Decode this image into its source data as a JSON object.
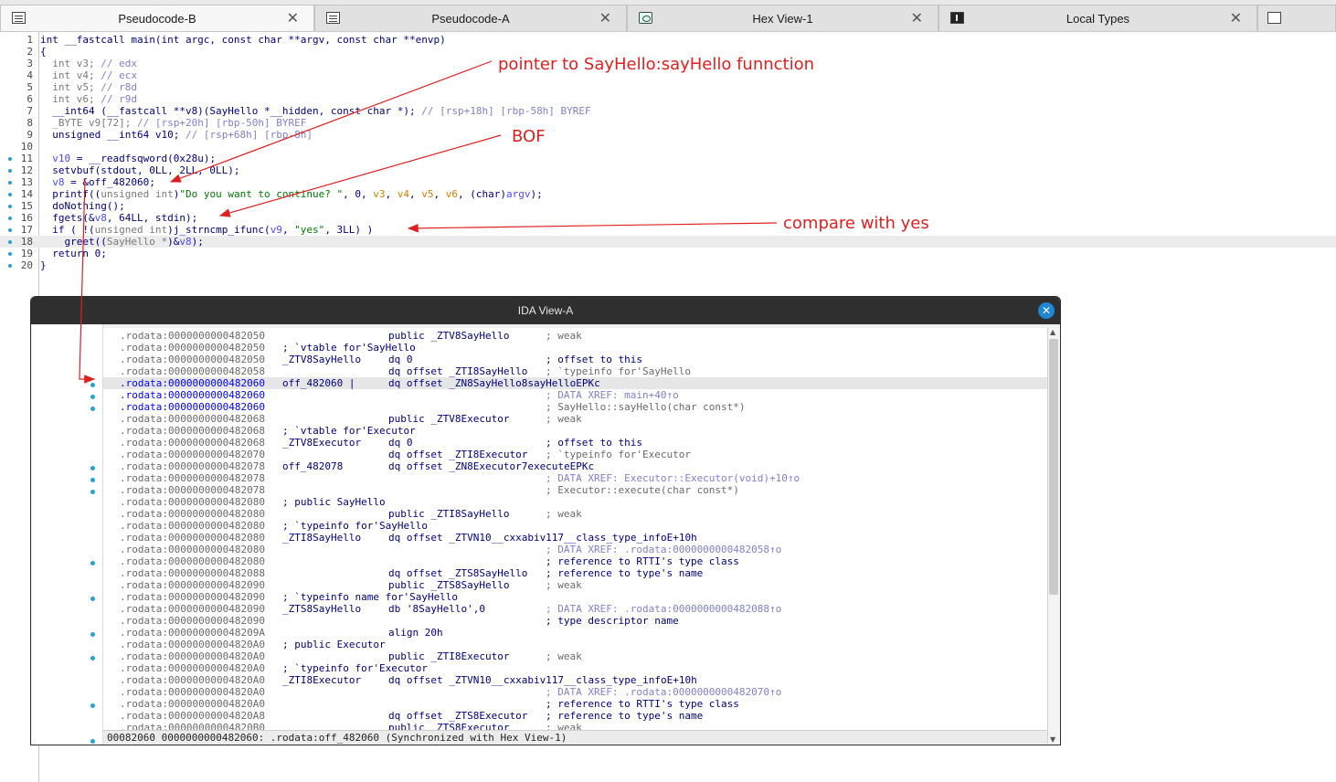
{
  "tabs": [
    {
      "label": "Pseudocode-B",
      "icon": "pseudocode-icon",
      "active": true
    },
    {
      "label": "Pseudocode-A",
      "icon": "pseudocode-icon",
      "active": false
    },
    {
      "label": "Hex View-1",
      "icon": "hex-view-icon",
      "active": false
    },
    {
      "label": "Local Types",
      "icon": "local-types-icon",
      "active": false
    }
  ],
  "pseudocode": [
    {
      "n": "1",
      "dot": false,
      "html": "<span class='kw'>int __fastcall main(int argc, const char **argv, const char **envp)</span>"
    },
    {
      "n": "2",
      "dot": false,
      "html": "{"
    },
    {
      "n": "3",
      "dot": false,
      "html": "  <span class='gy'>int v3;</span> <span class='cm'>// edx</span>"
    },
    {
      "n": "4",
      "dot": false,
      "html": "  <span class='gy'>int v4;</span> <span class='cm'>// ecx</span>"
    },
    {
      "n": "5",
      "dot": false,
      "html": "  <span class='gy'>int v5;</span> <span class='cm'>// r8d</span>"
    },
    {
      "n": "6",
      "dot": false,
      "html": "  <span class='gy'>int v6;</span> <span class='cm'>// r9d</span>"
    },
    {
      "n": "7",
      "dot": false,
      "html": "  __int64 (__fastcall **v8)(SayHello *__hidden, const char *); <span class='cm'>// [rsp+18h] [rbp-58h] BYREF</span>"
    },
    {
      "n": "8",
      "dot": false,
      "html": "  <span class='gy'>_BYTE v9[72];</span> <span class='cm'>// [rsp+20h] [rbp-50h] BYREF</span>"
    },
    {
      "n": "9",
      "dot": false,
      "html": "  unsigned __int64 v10; <span class='cm'>// [rsp+68h] [rbp-8h]</span>"
    },
    {
      "n": "10",
      "dot": false,
      "html": ""
    },
    {
      "n": "11",
      "dot": true,
      "html": "  <span class='vr'>v10</span> = __readfsqword(0x28u);"
    },
    {
      "n": "12",
      "dot": true,
      "html": "  setvbuf(stdout, 0LL, 2LL, 0LL);"
    },
    {
      "n": "13",
      "dot": true,
      "html": "  <span class='vr'>v8</span> = &amp;off_482060;"
    },
    {
      "n": "14",
      "dot": true,
      "html": "  printf((<span class='gy'>unsigned int</span>)<span class='st'>\"Do you want to continue? \"</span>, 0, <span class='ol'>v3</span>, <span class='ol'>v4</span>, <span class='ol'>v5</span>, <span class='ol'>v6</span>, (char)<span class='vr'>argv</span>);"
    },
    {
      "n": "15",
      "dot": true,
      "html": "  doNothing();"
    },
    {
      "n": "16",
      "dot": true,
      "html": "  fgets(&amp;<span class='vr'>v8</span>, 64LL, stdin);"
    },
    {
      "n": "17",
      "dot": true,
      "html": "  if ( !(<span class='gy'>unsigned int</span>)j_strncmp_ifunc(<span class='vr'>v9</span>, <span class='st'>\"yes\"</span>, 3LL) )"
    },
    {
      "n": "18",
      "dot": true,
      "html": "    greet((<span class='gy'>SayHello *</span>)&amp;<span class='vr'>v8</span>);",
      "hl": true
    },
    {
      "n": "19",
      "dot": true,
      "html": "  return 0;"
    },
    {
      "n": "20",
      "dot": true,
      "html": "}"
    }
  ],
  "annotations": {
    "pointer": "pointer to SayHello:sayHello funnction",
    "bof": "BOF",
    "compare": "compare with yes"
  },
  "ida_view": {
    "title": "IDA View-A",
    "status": "00082060 0000000000482060: .rodata:off_482060 (Synchronized with Hex View-1)",
    "rows": [
      {
        "a": ".rodata:0000000000482050",
        "b": "",
        "c": "public _ZTV8SayHello",
        "d": "; weak",
        "dcls": "cm"
      },
      {
        "a": ".rodata:0000000000482050",
        "b": "; `vtable for'SayHello",
        "c": "",
        "d": ""
      },
      {
        "a": ".rodata:0000000000482050",
        "b": "_ZTV8SayHello",
        "c": "dq 0",
        "d": "; offset to this",
        "dot": true
      },
      {
        "a": ".rodata:0000000000482058",
        "b": "",
        "c": "dq offset _ZTI8SayHello",
        "d": "; `typeinfo for'SayHello",
        "dcls": "cm",
        "dot": true
      },
      {
        "a": ".rodata:0000000000482060",
        "b": "off_482060 |",
        "c": "dq offset _ZN8SayHello8sayHelloEPKc",
        "d": "",
        "cur": true,
        "blue": true,
        "dot": true
      },
      {
        "a": ".rodata:0000000000482060",
        "b": "",
        "c": "",
        "d": "; DATA XREF: main+40↑o",
        "dcls": "xr",
        "blue": true
      },
      {
        "a": ".rodata:0000000000482060",
        "b": "",
        "c": "",
        "d": "; SayHello::sayHello(char const*)",
        "dcls": "cm",
        "blue": true
      },
      {
        "a": ".rodata:0000000000482068",
        "b": "",
        "c": "public _ZTV8Executor",
        "d": "; weak",
        "dcls": "cm"
      },
      {
        "a": ".rodata:0000000000482068",
        "b": "; `vtable for'Executor",
        "c": "",
        "d": ""
      },
      {
        "a": ".rodata:0000000000482068",
        "b": "_ZTV8Executor",
        "c": "dq 0",
        "d": "; offset to this",
        "dot": true
      },
      {
        "a": ".rodata:0000000000482070",
        "b": "",
        "c": "dq offset _ZTI8Executor",
        "d": "; `typeinfo for'Executor",
        "dcls": "cm",
        "dot": true
      },
      {
        "a": ".rodata:0000000000482078",
        "b": "off_482078",
        "c": "dq offset _ZN8Executor7executeEPKc",
        "d": "",
        "dot": true
      },
      {
        "a": ".rodata:0000000000482078",
        "b": "",
        "c": "",
        "d": "; DATA XREF: Executor::Executor(void)+10↑o",
        "dcls": "xr"
      },
      {
        "a": ".rodata:0000000000482078",
        "b": "",
        "c": "",
        "d": "; Executor::execute(char const*)",
        "dcls": "cm"
      },
      {
        "a": ".rodata:0000000000482080",
        "b": "; public SayHello",
        "c": "",
        "d": ""
      },
      {
        "a": ".rodata:0000000000482080",
        "b": "",
        "c": "public _ZTI8SayHello",
        "d": "; weak",
        "dcls": "cm"
      },
      {
        "a": ".rodata:0000000000482080",
        "b": "; `typeinfo for'SayHello",
        "c": "",
        "d": ""
      },
      {
        "a": ".rodata:0000000000482080",
        "b": "_ZTI8SayHello",
        "c": "dq offset _ZTVN10__cxxabiv117__class_type_infoE+10h",
        "d": "",
        "dot": true
      },
      {
        "a": ".rodata:0000000000482080",
        "b": "",
        "c": "",
        "d": "; DATA XREF: .rodata:0000000000482058↑o",
        "dcls": "xr"
      },
      {
        "a": ".rodata:0000000000482080",
        "b": "",
        "c": "",
        "d": "; reference to RTTI's type class"
      },
      {
        "a": ".rodata:0000000000482088",
        "b": "",
        "c": "dq offset _ZTS8SayHello",
        "d": "; reference to type's name",
        "dot": true
      },
      {
        "a": ".rodata:0000000000482090",
        "b": "",
        "c": "public _ZTS8SayHello",
        "d": "; weak",
        "dcls": "cm"
      },
      {
        "a": ".rodata:0000000000482090",
        "b": "; `typeinfo name for'SayHello",
        "c": "",
        "d": ""
      },
      {
        "a": ".rodata:0000000000482090",
        "b": "_ZTS8SayHello",
        "c": "db '8SayHello',0",
        "d": "; DATA XREF: .rodata:0000000000482088↑o",
        "dcls": "xr",
        "dot": true
      },
      {
        "a": ".rodata:0000000000482090",
        "b": "",
        "c": "",
        "d": "; type descriptor name"
      },
      {
        "a": ".rodata:000000000048209A",
        "b": "",
        "c": "align 20h",
        "d": "",
        "dot": true
      },
      {
        "a": ".rodata:00000000004820A0",
        "b": "; public Executor",
        "c": "",
        "d": ""
      },
      {
        "a": ".rodata:00000000004820A0",
        "b": "",
        "c": "public _ZTI8Executor",
        "d": "; weak",
        "dcls": "cm"
      },
      {
        "a": ".rodata:00000000004820A0",
        "b": "; `typeinfo for'Executor",
        "c": "",
        "d": ""
      },
      {
        "a": ".rodata:00000000004820A0",
        "b": "_ZTI8Executor",
        "c": "dq offset _ZTVN10__cxxabiv117__class_type_infoE+10h",
        "d": "",
        "dot": true
      },
      {
        "a": ".rodata:00000000004820A0",
        "b": "",
        "c": "",
        "d": "; DATA XREF: .rodata:0000000000482070↑o",
        "dcls": "xr"
      },
      {
        "a": ".rodata:00000000004820A0",
        "b": "",
        "c": "",
        "d": "; reference to RTTI's type class"
      },
      {
        "a": ".rodata:00000000004820A8",
        "b": "",
        "c": "dq offset _ZTS8Executor",
        "d": "; reference to type's name",
        "dot": true
      },
      {
        "a": ".rodata:00000000004820B0",
        "b": "",
        "c": "public _ZTS8Executor",
        "d": "; weak",
        "dcls": "cm"
      }
    ]
  },
  "colors": {
    "annotation": "#e02020",
    "accent": "#1e88d6",
    "dot": "#2aa0d8"
  }
}
